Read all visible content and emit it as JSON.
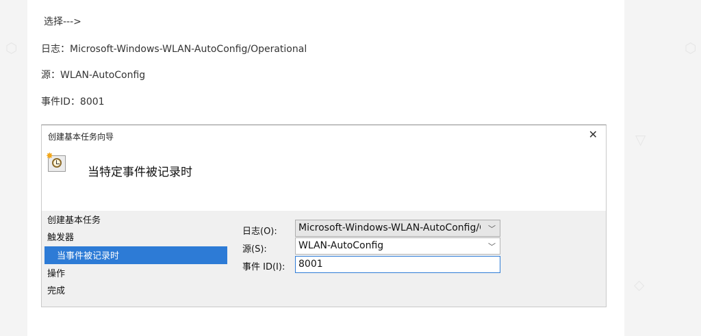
{
  "article": {
    "lines": [
      "选择--->",
      "日志：Microsoft-Windows-WLAN-AutoConfig/Operational",
      "源：WLAN-AutoConfig",
      "事件ID：8001"
    ]
  },
  "dialog": {
    "title": "创建基本任务向导",
    "close_symbol": "✕",
    "heading": "当特定事件被记录时",
    "icon": "scheduled-task-clock-icon",
    "nav": {
      "items": [
        {
          "label": "创建基本任务",
          "selected": false
        },
        {
          "label": "触发器",
          "selected": false
        },
        {
          "label": "当事件被记录时",
          "selected": true
        },
        {
          "label": "操作",
          "selected": false
        },
        {
          "label": "完成",
          "selected": false
        }
      ]
    },
    "form": {
      "log_label": "日志(O):",
      "log_value": "Microsoft-Windows-WLAN-AutoConfig/C",
      "source_label": "源(S):",
      "source_value": "WLAN-AutoConfig",
      "event_id_label": "事件 ID(I):",
      "event_id_value": "8001"
    }
  },
  "colors": {
    "selection": "#2d7bd6",
    "dialog_body": "#f0f0f0",
    "page_background": "#f4f4f4"
  }
}
